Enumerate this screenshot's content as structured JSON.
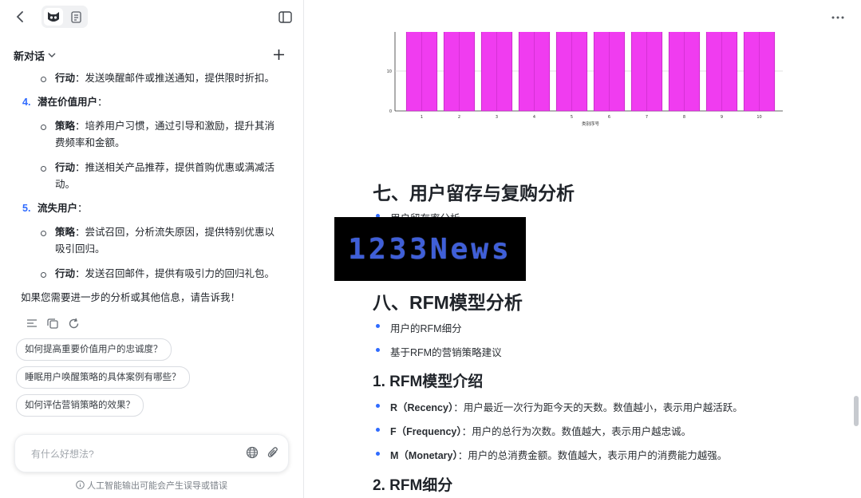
{
  "left_panel": {
    "chat_title": "新对话",
    "message": {
      "item1_action_label": "行动",
      "item1_action_text": "：发送唤醒邮件或推送通知，提供限时折扣。",
      "item4_num": "4.",
      "item4_title": "潜在价值用户",
      "item4_colon": "：",
      "item4_strategy_label": "策略",
      "item4_strategy_text1": "：培养用户习惯，通过引导和激励，提升其消",
      "item4_strategy_text2": "费频率和金额。",
      "item4_action_label": "行动",
      "item4_action_text1": "：推送相关产品推荐，提供首购优惠或满减活",
      "item4_action_text2": "动。",
      "item5_num": "5.",
      "item5_title": "流失用户",
      "item5_colon": "：",
      "item5_strategy_label": "策略",
      "item5_strategy_text1": "：尝试召回，分析流失原因，提供特别优惠以",
      "item5_strategy_text2": "吸引回归。",
      "item5_action_label": "行动",
      "item5_action_text": "：发送召回邮件，提供有吸引力的回归礼包。",
      "closing": "如果您需要进一步的分析或其他信息，请告诉我！"
    },
    "suggestions": [
      "如何提高重要价值用户的忠诚度？",
      "睡眠用户唤醒策略的具体案例有哪些？",
      "如何评估营销策略的效果？"
    ],
    "input_placeholder": "有什么好想法?",
    "disclaimer": "人工智能输出可能会产生误导或错误"
  },
  "document": {
    "section7_title": "七、用户留存与复购分析",
    "section7_item1": "用户留存率分析",
    "section8_title": "八、RFM模型分析",
    "section8_items": [
      "用户的RFM细分",
      "基于RFM的营销策略建议"
    ],
    "sub1_title": "1. RFM模型介绍",
    "rfm_items": [
      {
        "label": "R（Recency）",
        "text": "：用户最近一次行为距今天的天数。数值越小，表示用户越活跃。"
      },
      {
        "label": "F（Frequency）",
        "text": "：用户的总行为次数。数值越大，表示用户越忠诚。"
      },
      {
        "label": "M（Monetary）",
        "text": "：用户的总消费金额。数值越大，表示用户的消费能力越强。"
      }
    ],
    "sub2_title": "2. RFM细分"
  },
  "watermark": "1233News",
  "chart_data": {
    "type": "bar",
    "categories": [
      "1",
      "2",
      "3",
      "4",
      "5",
      "6",
      "7",
      "8",
      "9",
      "10"
    ],
    "values": [
      20,
      20,
      20,
      20,
      20,
      20,
      20,
      20,
      20,
      20
    ],
    "xlabel": "类别序号",
    "ylabel": "",
    "yticks": [
      "0",
      "10"
    ],
    "ylim": [
      0,
      20
    ],
    "bar_color": "#f03cf0"
  },
  "colors": {
    "accent": "#2f6bff",
    "bar": "#f03cf0"
  }
}
